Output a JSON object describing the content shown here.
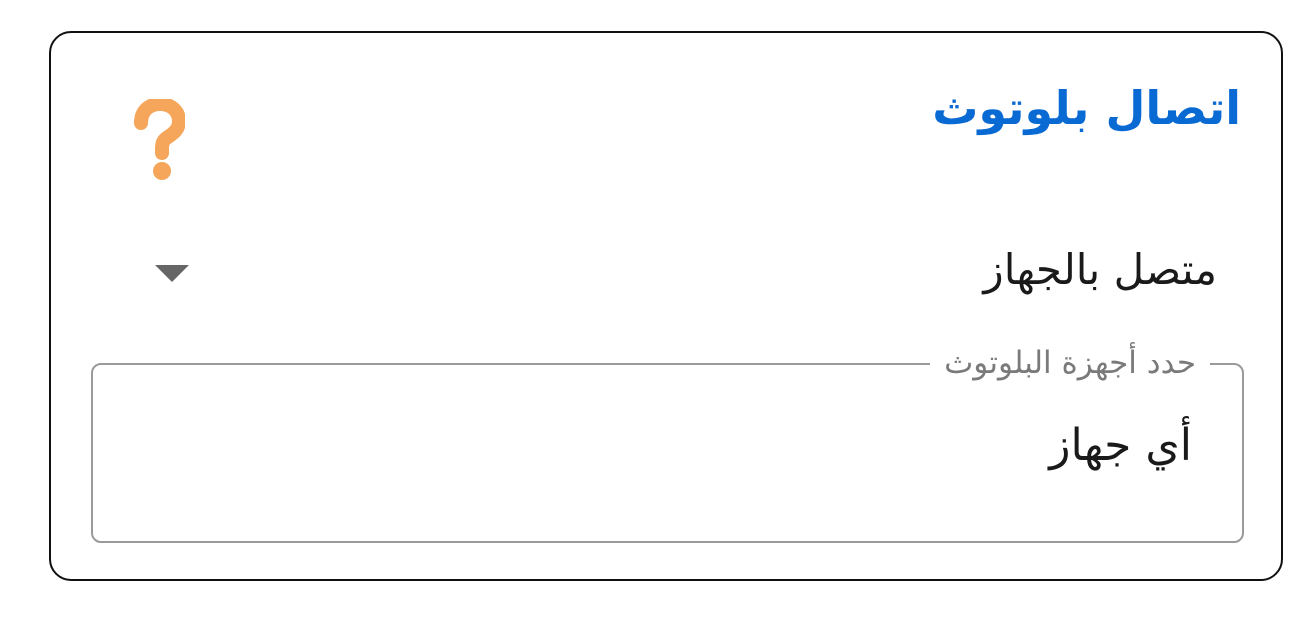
{
  "bluetooth_panel": {
    "title": "اتصال بلوتوث",
    "help_icon": "question-mark-icon",
    "connection_select": {
      "value": "متصل بالجهاز",
      "arrow_icon": "dropdown-arrow-icon"
    },
    "device_field": {
      "legend": "حدد أجهزة البلوتوث",
      "value": "أي جهاز"
    }
  },
  "colors": {
    "title": "#0a6ad3",
    "help_icon": "#f5a65a",
    "card_border": "#111111",
    "field_border": "#9a9a9a"
  }
}
